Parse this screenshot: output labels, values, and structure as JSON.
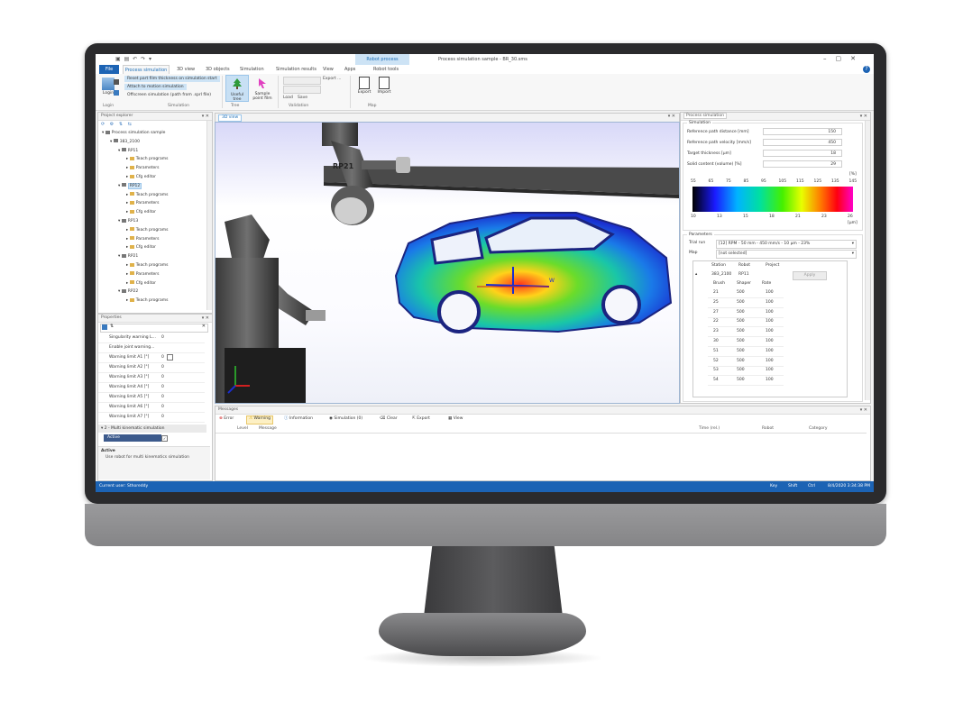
{
  "titlebar": {
    "title": "Process simulation sample - BR_30.sms",
    "context_tab": "Robot process"
  },
  "ribbon_tabs": [
    {
      "label": "File"
    },
    {
      "label": "Process simulation"
    },
    {
      "label": "3D view"
    },
    {
      "label": "3D objects"
    },
    {
      "label": "Simulation"
    },
    {
      "label": "Simulation results"
    },
    {
      "label": "View"
    },
    {
      "label": "Apps"
    },
    {
      "label": "Robot tools"
    }
  ],
  "ribbon": {
    "login_label": "Login",
    "menu_items": [
      "Reset part film thickness on simulation start",
      "Attach to motion simulation",
      "Offscreen simulation (path from .sprl file)"
    ],
    "group_login": "Login",
    "group_simulation": "Simulation",
    "useful_tree_label": "Useful tree",
    "sample_point_label": "Sample point film",
    "group_tree": "Tree",
    "load_label": "Load",
    "save_label": "Save",
    "export_dropdown": "Export ...",
    "group_validation": "Validation",
    "export_label": "Export",
    "import_label": "Import",
    "group_map": "Map"
  },
  "explorer": {
    "title": "Project explorer",
    "tree": [
      {
        "label": "Process simulation sample",
        "level": 0
      },
      {
        "label": "383_2100",
        "level": 1
      },
      {
        "label": "RP11",
        "level": 2
      },
      {
        "label": "Teach programs",
        "level": 3
      },
      {
        "label": "Parameters",
        "level": 3
      },
      {
        "label": "Cfg editor",
        "level": 3
      },
      {
        "label": "RP12",
        "level": 2,
        "selected": true
      },
      {
        "label": "Teach programs",
        "level": 3
      },
      {
        "label": "Parameters",
        "level": 3
      },
      {
        "label": "Cfg editor",
        "level": 3
      },
      {
        "label": "RP13",
        "level": 2
      },
      {
        "label": "Teach programs",
        "level": 3
      },
      {
        "label": "Parameters",
        "level": 3
      },
      {
        "label": "Cfg editor",
        "level": 3
      },
      {
        "label": "RP21",
        "level": 2
      },
      {
        "label": "Teach programs",
        "level": 3
      },
      {
        "label": "Parameters",
        "level": 3
      },
      {
        "label": "Cfg editor",
        "level": 3
      },
      {
        "label": "RP22",
        "level": 2
      },
      {
        "label": "Teach programs",
        "level": 3
      }
    ]
  },
  "properties": {
    "title": "Properties",
    "rows": [
      {
        "k": "Singularity warning L...",
        "v": "0"
      },
      {
        "k": "Enable joint warning...",
        "v": ""
      },
      {
        "k": "Warning limit A1 [°]",
        "v": "0"
      },
      {
        "k": "Warning limit A2 [°]",
        "v": "0"
      },
      {
        "k": "Warning limit A3 [°]",
        "v": "0"
      },
      {
        "k": "Warning limit A4 [°]",
        "v": "0"
      },
      {
        "k": "Warning limit A5 [°]",
        "v": "0"
      },
      {
        "k": "Warning limit A6 [°]",
        "v": "0"
      },
      {
        "k": "Warning limit A7 [°]",
        "v": "0"
      }
    ],
    "section": "2 - Multi kinematic simulation",
    "active_key": "Active",
    "desc_title": "Active",
    "desc_text": "Use robot for multi kinematics simulation"
  },
  "viewport": {
    "tab": "3D view",
    "robot_label": "RP21",
    "axis_label": "W"
  },
  "sim_panel": {
    "title": "Process simulation",
    "section_sim": "Simulation",
    "fields": [
      {
        "label": "Reference path distance [mm]",
        "value": "150"
      },
      {
        "label": "Reference path velocity [mm/s]",
        "value": "450"
      },
      {
        "label": "Target thickness [µm]",
        "value": "18"
      },
      {
        "label": "Solid content (volume) [%]",
        "value": "29"
      }
    ],
    "scale_unit_top": "[%]",
    "scale_top": [
      "55",
      "65",
      "75",
      "85",
      "95",
      "105",
      "115",
      "125",
      "135",
      "145"
    ],
    "scale_bottom": [
      "10",
      "13",
      "15",
      "18",
      "21",
      "23",
      "26"
    ],
    "scale_unit_bottom": "[µm]",
    "section_params": "Parameters",
    "trial_run_label": "Trial run",
    "trial_run_value": "[12] RPM - 50 mm - 450 mm/s - 10 µm - 23%",
    "map_label": "Map",
    "map_value": "[not selected]",
    "table_headers": [
      "Station",
      "Robot",
      "Project"
    ],
    "station": "383_2100",
    "robot": "RP11",
    "apply_label": "Apply",
    "sub_headers": [
      "Brush",
      "Shaper",
      "Rate"
    ],
    "rows": [
      [
        "21",
        "500",
        "100"
      ],
      [
        "25",
        "500",
        "100"
      ],
      [
        "27",
        "500",
        "100"
      ],
      [
        "22",
        "500",
        "100"
      ],
      [
        "23",
        "500",
        "100"
      ],
      [
        "30",
        "500",
        "100"
      ],
      [
        "51",
        "500",
        "100"
      ],
      [
        "52",
        "500",
        "100"
      ],
      [
        "53",
        "500",
        "100"
      ],
      [
        "54",
        "500",
        "100"
      ]
    ]
  },
  "messages": {
    "title": "Messages",
    "buttons": [
      "Error",
      "Warning",
      "Information",
      "Simulation (0)",
      "Clear",
      "Export",
      "View"
    ],
    "col_level": "Level",
    "col_message": "Message",
    "col_time": "Time (rel.)",
    "col_robot": "Robot",
    "col_category": "Category"
  },
  "statusbar": {
    "left": "Current user: Sthoreddy",
    "right_a": "Key",
    "right_b": "Shift",
    "right_c": "Ctrl",
    "datetime": "8/4/2020 3:34:38 PM"
  },
  "colors": {
    "accent": "#1c63b4",
    "selection": "#cde3f5"
  }
}
